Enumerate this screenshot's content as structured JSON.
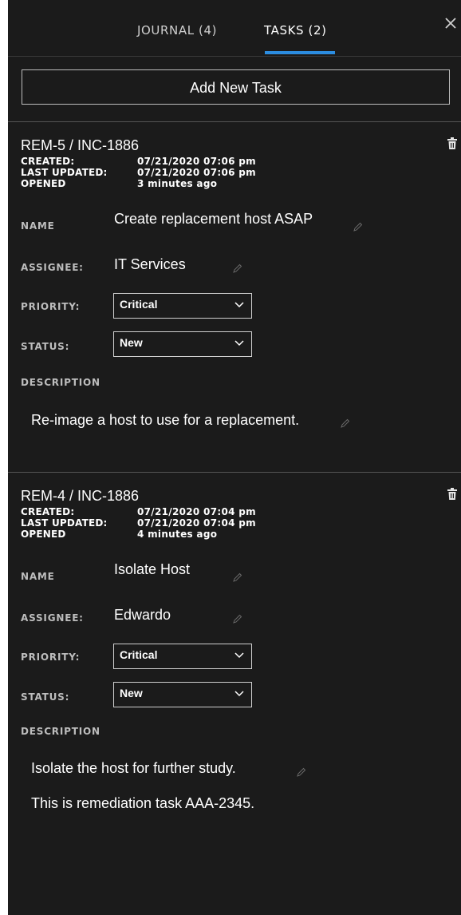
{
  "tabs": [
    {
      "label": "JOURNAL (4)"
    },
    {
      "label": "TASKS (2)"
    }
  ],
  "add_button": "Add New Task",
  "tasks": [
    {
      "title": "REM-5 / INC-1886",
      "created_label": "CREATED:",
      "created": "07/21/2020 07:06 pm",
      "updated_label": "LAST UPDATED:",
      "updated": "07/21/2020 07:06 pm",
      "opened_label": "OPENED",
      "opened": "3 minutes ago",
      "name_label": "NAME",
      "name": "Create replacement host ASAP",
      "assignee_label": "ASSIGNEE:",
      "assignee": "IT Services",
      "priority_label": "PRIORITY:",
      "priority": "Critical",
      "status_label": "STATUS:",
      "status": "New",
      "description_label": "DESCRIPTION",
      "description": [
        "Re-image a host to use  for a replacement."
      ]
    },
    {
      "title": "REM-4 / INC-1886",
      "created_label": "CREATED:",
      "created": "07/21/2020 07:04 pm",
      "updated_label": "LAST UPDATED:",
      "updated": "07/21/2020 07:04 pm",
      "opened_label": "OPENED",
      "opened": "4 minutes ago",
      "name_label": "NAME",
      "name": "Isolate Host",
      "assignee_label": "ASSIGNEE:",
      "assignee": "Edwardo",
      "priority_label": "PRIORITY:",
      "priority": "Critical",
      "status_label": "STATUS:",
      "status": "New",
      "description_label": "DESCRIPTION",
      "description": [
        "Isolate the host for further study.",
        "This is remediation task AAA-2345."
      ]
    }
  ],
  "icons": {
    "close": "close-icon",
    "delete": "trash-icon",
    "edit": "pencil-icon",
    "dropdown": "chevron-down-icon"
  },
  "colors": {
    "panel_background": "#1b1b1b",
    "active_tab_underline": "#2c8de0",
    "text": "#ffffff"
  }
}
